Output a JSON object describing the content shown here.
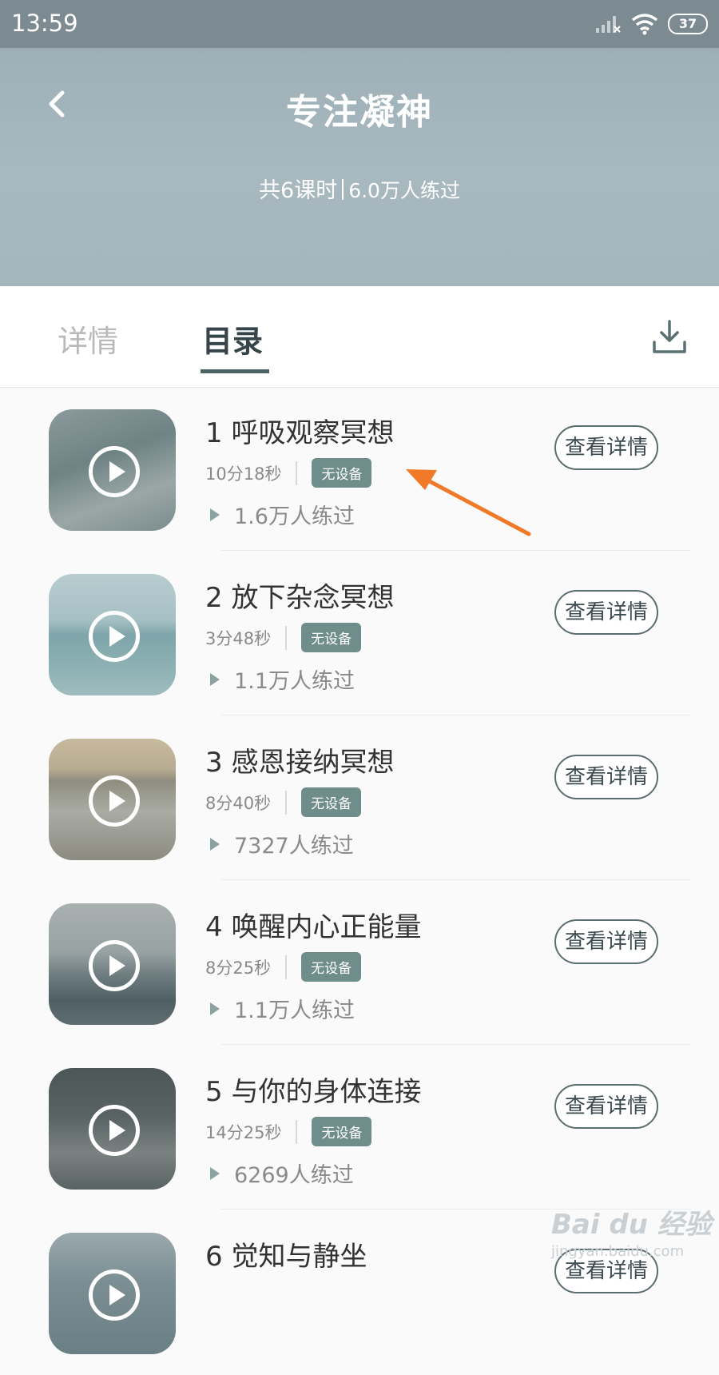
{
  "status": {
    "time": "13:59",
    "battery": "37"
  },
  "header": {
    "title": "专注凝神",
    "course_count": "共6课时",
    "practiced_total": "6.0万人练过"
  },
  "tabs": [
    {
      "label": "详情",
      "active": false
    },
    {
      "label": "目录",
      "active": true
    }
  ],
  "lessons": [
    {
      "title": "1 呼吸观察冥想",
      "duration": "10分18秒",
      "badge": "无设备",
      "plays": "1.6万人练过",
      "button": "查看详情"
    },
    {
      "title": "2 放下杂念冥想",
      "duration": "3分48秒",
      "badge": "无设备",
      "plays": "1.1万人练过",
      "button": "查看详情"
    },
    {
      "title": "3 感恩接纳冥想",
      "duration": "8分40秒",
      "badge": "无设备",
      "plays": "7327人练过",
      "button": "查看详情"
    },
    {
      "title": "4 唤醒内心正能量",
      "duration": "8分25秒",
      "badge": "无设备",
      "plays": "1.1万人练过",
      "button": "查看详情"
    },
    {
      "title": "5 与你的身体连接",
      "duration": "14分25秒",
      "badge": "无设备",
      "plays": "6269人练过",
      "button": "查看详情"
    },
    {
      "title": "6 觉知与静坐",
      "duration": "",
      "badge": "",
      "plays": "",
      "button": "查看详情"
    }
  ],
  "watermark": {
    "top": "Bai du 经验",
    "bottom": "jingyan.baidu.com"
  },
  "colors": {
    "accent": "#4b6366",
    "badge": "#6f8d8a",
    "annotation_arrow": "#f07a2a"
  }
}
